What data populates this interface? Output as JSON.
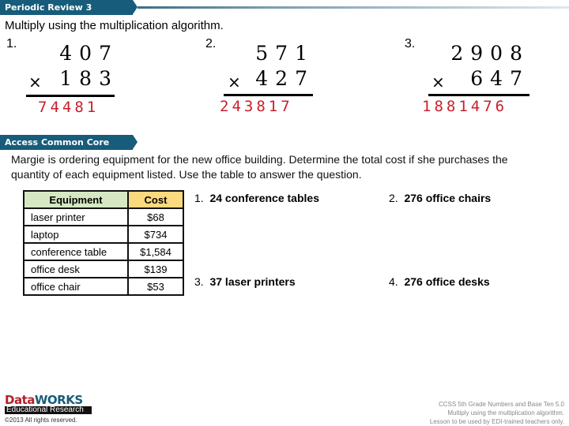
{
  "header": {
    "section_title": "Periodic Review 3",
    "instruction": "Multiply using the multiplication algorithm."
  },
  "problems": [
    {
      "number": "1.",
      "multiplicand": "407",
      "multiplier": "183",
      "operator": "×",
      "answer": "74481"
    },
    {
      "number": "2.",
      "multiplicand": "571",
      "multiplier": "427",
      "operator": "×",
      "answer": "243817"
    },
    {
      "number": "3.",
      "multiplicand": "2908",
      "multiplier": "647",
      "operator": "×",
      "answer": "1881476"
    }
  ],
  "access": {
    "section_title": "Access Common Core",
    "prompt": "Margie is ordering equipment for the new office building. Determine the total cost if she purchases the quantity of each equipment listed. Use the table to answer the question."
  },
  "table": {
    "headers": [
      "Equipment",
      "Cost"
    ],
    "header_colors": [
      "#d5e8c3",
      "#fbd97e"
    ],
    "rows": [
      [
        "laser printer",
        "$68"
      ],
      [
        "laptop",
        "$734"
      ],
      [
        "conference table",
        "$1,584"
      ],
      [
        "office desk",
        "$139"
      ],
      [
        "office chair",
        "$53"
      ]
    ]
  },
  "questions": [
    {
      "number": "1.",
      "text": "24 conference tables"
    },
    {
      "number": "2.",
      "text": "276 office chairs"
    },
    {
      "number": "3.",
      "text": "37 laser printers"
    },
    {
      "number": "4.",
      "text": "276 office desks"
    }
  ],
  "footer": {
    "logo_part1": "Data",
    "logo_part2": "WORKS",
    "logo_sub": "Educational Research",
    "copyright": "©2013 All rights reserved.",
    "notes": [
      "CCSS 5th Grade Numbers and Base Ten 5.0",
      "Multiply using the multiplication algorithm.",
      "Lesson to be used by EDI-trained teachers only."
    ]
  },
  "colors": {
    "banner": "#175c7a",
    "answer_red": "#c8202b"
  }
}
